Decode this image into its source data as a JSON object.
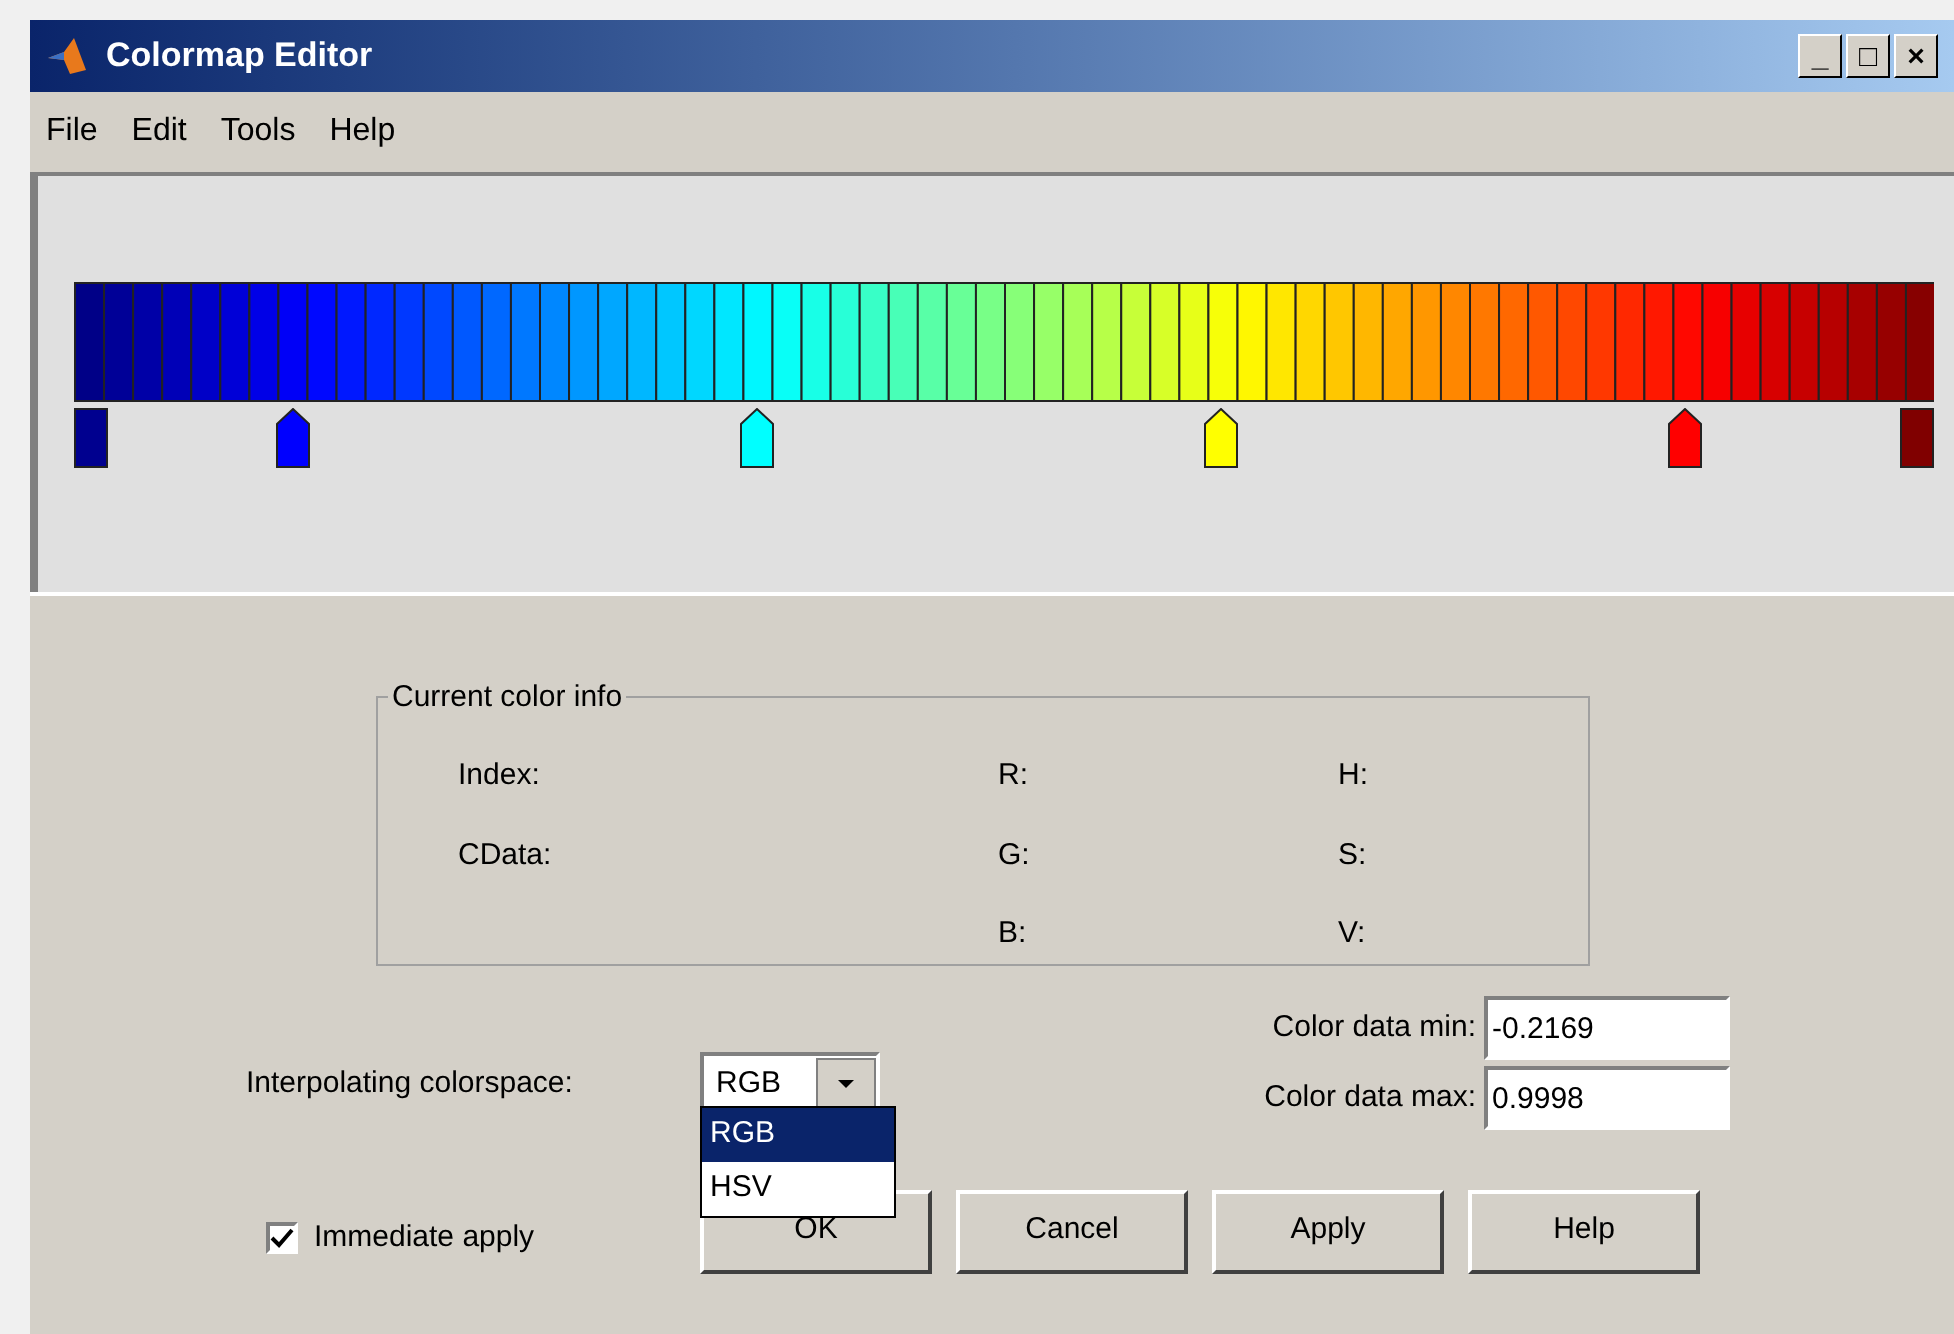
{
  "window": {
    "title": "Colormap Editor",
    "controls": [
      "_",
      "□",
      "×"
    ]
  },
  "menu": [
    "File",
    "Edit",
    "Tools",
    "Help"
  ],
  "markers": [
    {
      "kind": "end",
      "level": 0,
      "color": "#00008f"
    },
    {
      "kind": "pointer",
      "level": 0.111,
      "color": "#0000ff"
    },
    {
      "kind": "pointer",
      "level": 0.365,
      "color": "#00ffff"
    },
    {
      "kind": "pointer",
      "level": 0.619,
      "color": "#ffff00"
    },
    {
      "kind": "pointer",
      "level": 0.873,
      "color": "#ff0000"
    },
    {
      "kind": "end",
      "level": 1,
      "color": "#800000"
    }
  ],
  "color_info": {
    "title": "Current color info",
    "columns": [
      [
        "Index:",
        "CData:"
      ],
      [
        "R:",
        "G:",
        "B:"
      ],
      [
        "H:",
        "S:",
        "V:"
      ]
    ]
  },
  "colorspace": {
    "label": "Interpolating colorspace:",
    "value": "RGB",
    "options": [
      {
        "label": "RGB",
        "selected": true
      },
      {
        "label": "HSV",
        "selected": false
      }
    ]
  },
  "data_fields": [
    {
      "label": "Color data min:",
      "value": "-0.2169"
    },
    {
      "label": "Color data max:",
      "value": "0.9998"
    }
  ],
  "immediate_apply": {
    "label": "Immediate apply",
    "checked": true
  },
  "buttons": [
    "OK",
    "Cancel",
    "Apply",
    "Help"
  ]
}
